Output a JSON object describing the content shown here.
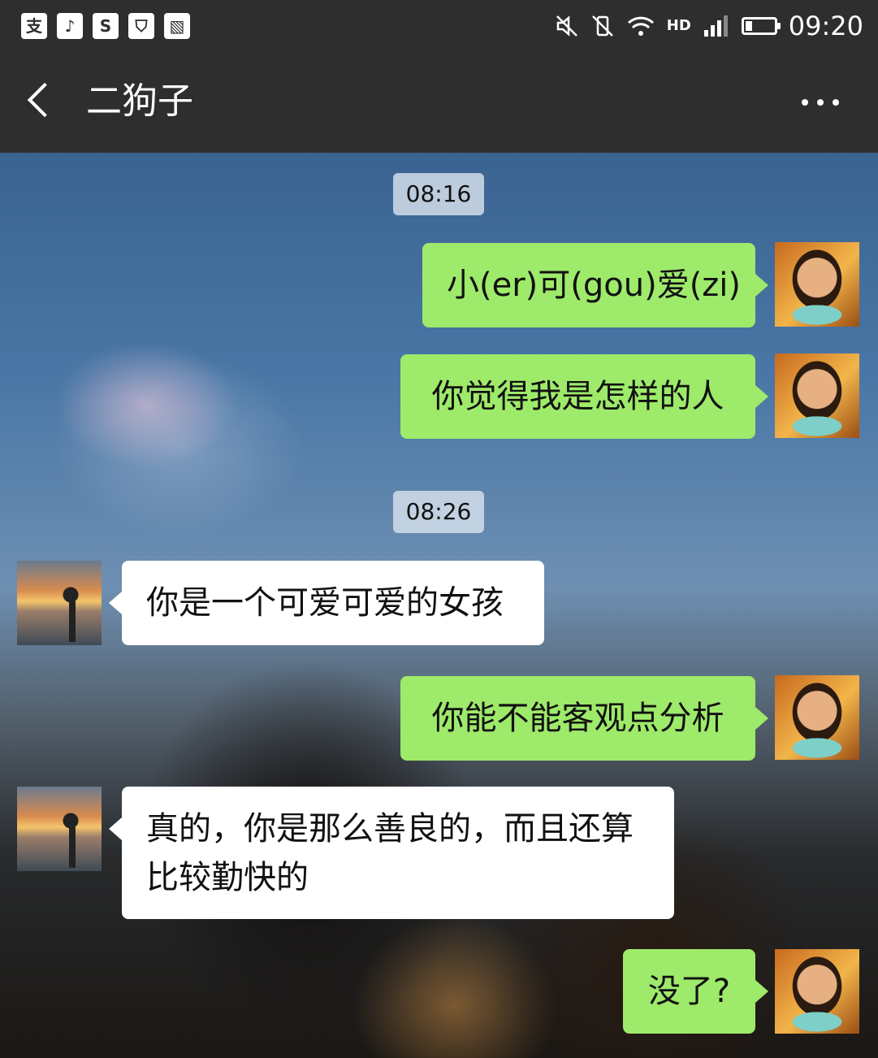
{
  "status_bar": {
    "left_icons": [
      "alipay-icon",
      "music-icon",
      "s-app-icon",
      "shield-icon",
      "image-icon"
    ],
    "left_icon_glyphs": [
      "支",
      "♪",
      "S",
      "⛉",
      "▧"
    ],
    "right_icons": [
      "mute-icon",
      "vibrate-off-icon",
      "wifi-icon",
      "hd-signal-icon",
      "battery-icon"
    ],
    "hd_label": "HD",
    "time": "09:20"
  },
  "header": {
    "title": "二狗子",
    "back_icon": "back-chevron-icon",
    "more_icon": "more-dots-icon"
  },
  "timestamps": [
    "08:16",
    "08:26"
  ],
  "messages": [
    {
      "from": "me",
      "text": "小(er)可(gou)爱(zi)"
    },
    {
      "from": "me",
      "text": "你觉得我是怎样的人"
    },
    {
      "from": "friend",
      "text": "你是一个可爱可爱的女孩"
    },
    {
      "from": "me",
      "text": "你能不能客观点分析"
    },
    {
      "from": "friend",
      "lines": [
        "真的，你是那么善良的，而且还算",
        "比较勤快的"
      ]
    },
    {
      "from": "me",
      "text": "没了?"
    }
  ],
  "colors": {
    "outgoing_bubble": "#9eea6a",
    "incoming_bubble": "#ffffff",
    "bar_background": "#2e2e2e"
  }
}
